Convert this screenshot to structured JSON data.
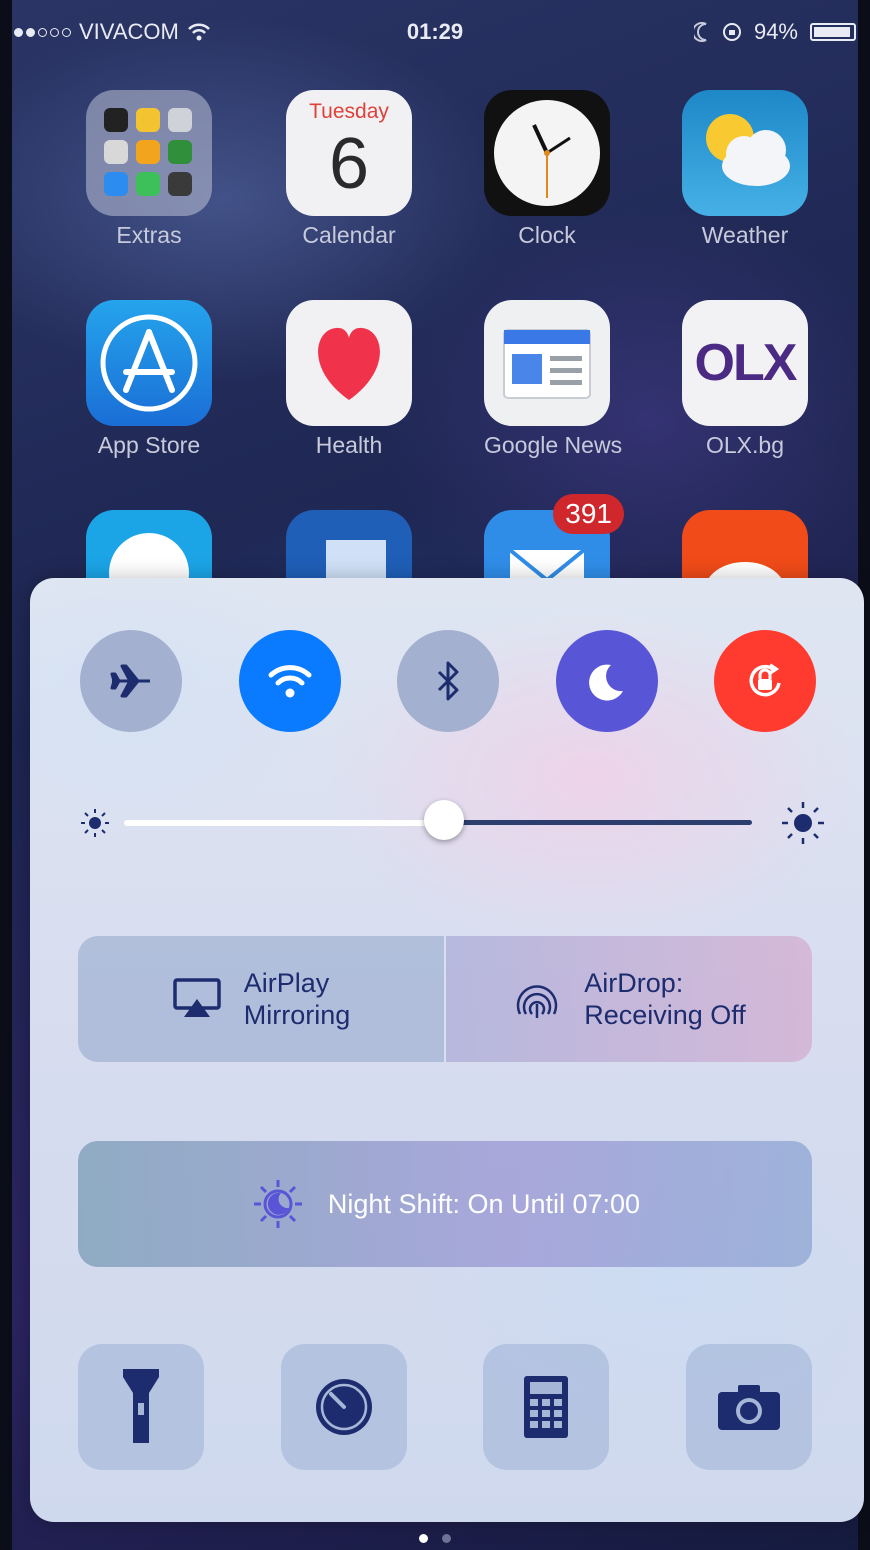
{
  "status_bar": {
    "carrier": "VIVACOM",
    "time": "01:29",
    "battery": "94%"
  },
  "apps": [
    {
      "label": "Extras",
      "icon": "folder-icon"
    },
    {
      "label": "Calendar",
      "icon": "calendar-icon",
      "day": "Tuesday",
      "date": "6"
    },
    {
      "label": "Clock",
      "icon": "clock-icon"
    },
    {
      "label": "Weather",
      "icon": "weather-icon"
    },
    {
      "label": "App Store",
      "icon": "app-store-icon"
    },
    {
      "label": "Health",
      "icon": "heart-icon"
    },
    {
      "label": "Google News",
      "icon": "google-news-icon"
    },
    {
      "label": "OLX.bg",
      "icon": "olx-icon",
      "logo_text": "OLX"
    }
  ],
  "mail_badge": "391",
  "control_center": {
    "toggles": [
      {
        "name": "airplane-mode",
        "on": false
      },
      {
        "name": "wifi",
        "on": true,
        "color": "#0a7aff"
      },
      {
        "name": "bluetooth",
        "on": false
      },
      {
        "name": "do-not-disturb",
        "on": true,
        "color": "#5856d6"
      },
      {
        "name": "rotation-lock",
        "on": true,
        "color": "#ff3b30"
      }
    ],
    "brightness_level": 0.43,
    "airplay": {
      "line1": "AirPlay",
      "line2": "Mirroring"
    },
    "airdrop": {
      "line1": "AirDrop:",
      "line2": "Receiving Off"
    },
    "night_shift": "Night Shift: On Until 07:00",
    "tools": [
      "flashlight",
      "timer",
      "calculator",
      "camera"
    ]
  },
  "page_dots": {
    "count": 2,
    "active": 1
  }
}
